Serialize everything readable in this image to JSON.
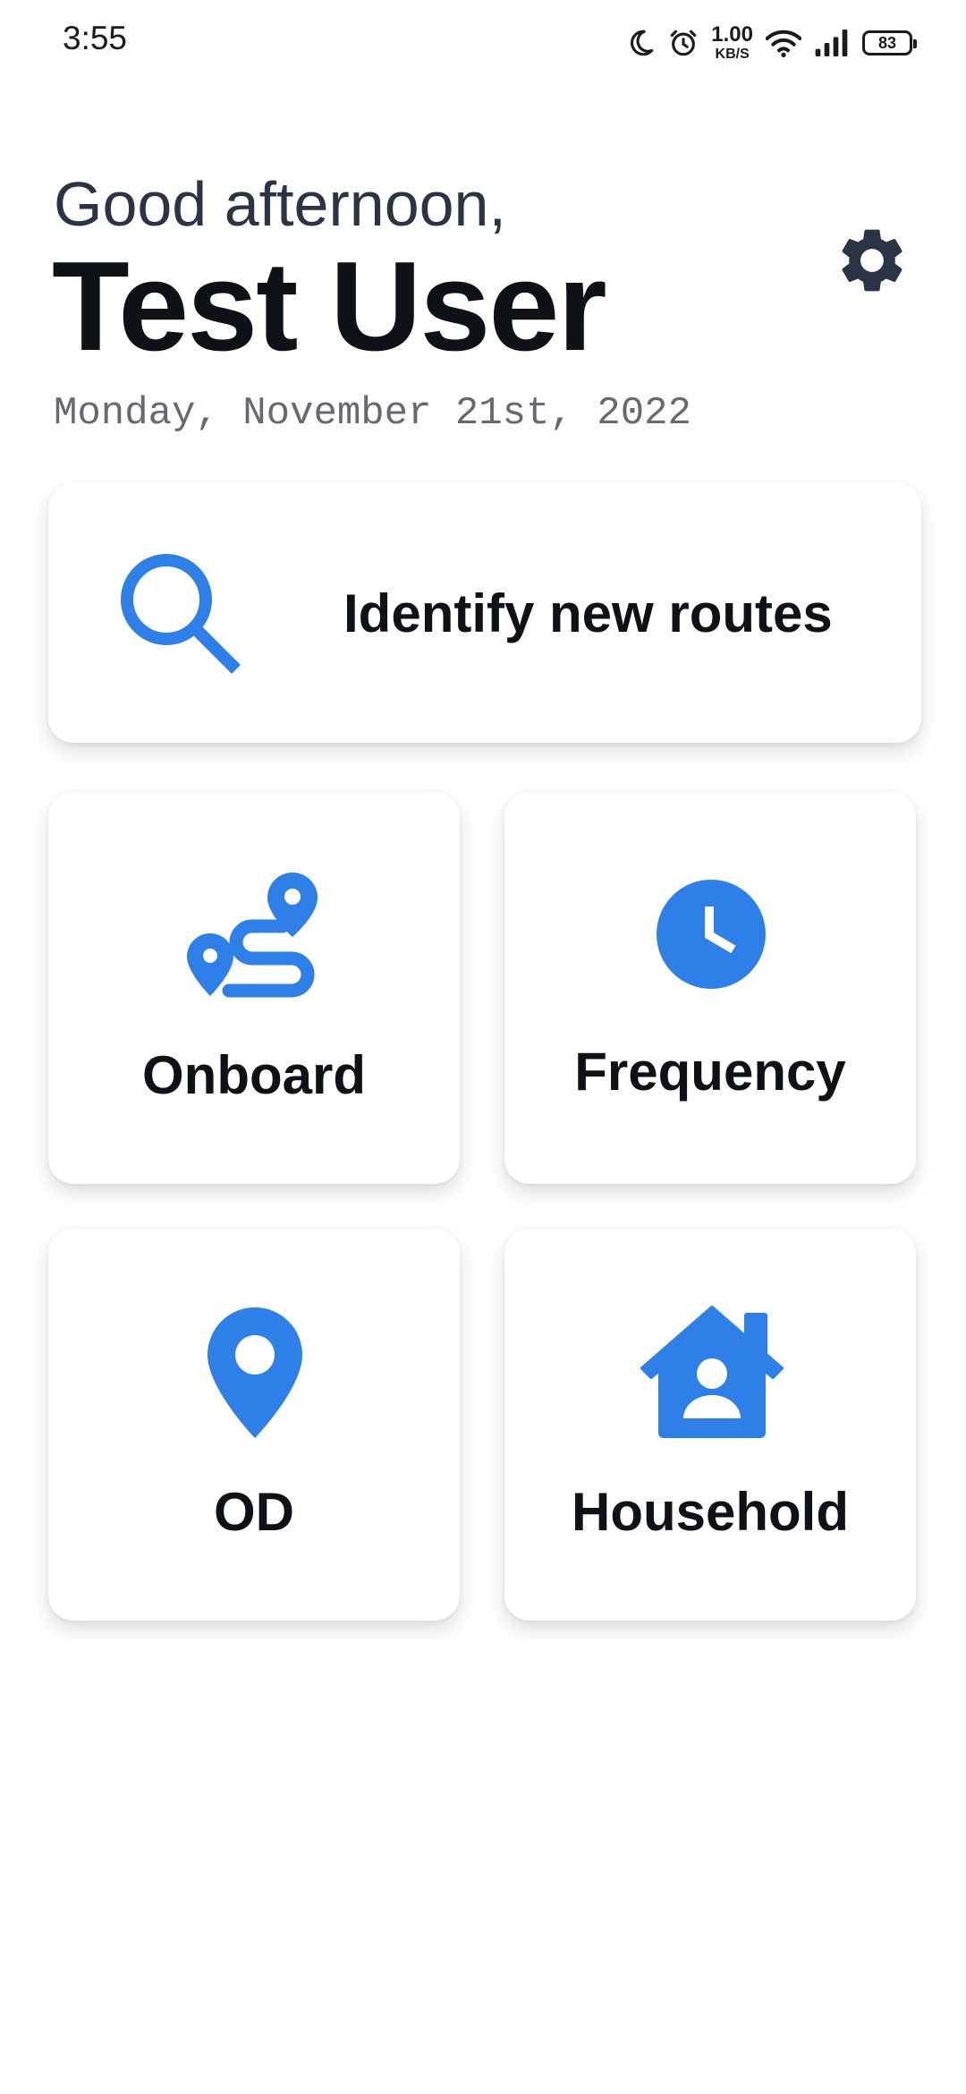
{
  "status_bar": {
    "time": "3:55",
    "speed_value": "1.00",
    "speed_unit": "KB/S",
    "battery": "83",
    "icons": [
      "moon-icon",
      "alarm-icon",
      "wifi-icon",
      "signal-icon",
      "battery-icon"
    ]
  },
  "header": {
    "greeting": "Good afternoon,",
    "user_name": "Test User",
    "date": "Monday, November 21st, 2022",
    "settings_icon": "gear-icon"
  },
  "actions": {
    "identify": {
      "label": "Identify new routes",
      "icon": "search-icon"
    },
    "tiles": [
      {
        "label": "Onboard",
        "icon": "route-icon"
      },
      {
        "label": "Frequency",
        "icon": "clock-icon"
      },
      {
        "label": "OD",
        "icon": "map-pin-icon"
      },
      {
        "label": "Household",
        "icon": "house-user-icon"
      }
    ]
  },
  "colors": {
    "accent": "#2f7fe8",
    "title": "#0e1116",
    "greeting": "#2b3444",
    "date": "#666a70",
    "gear": "#2b3444"
  }
}
